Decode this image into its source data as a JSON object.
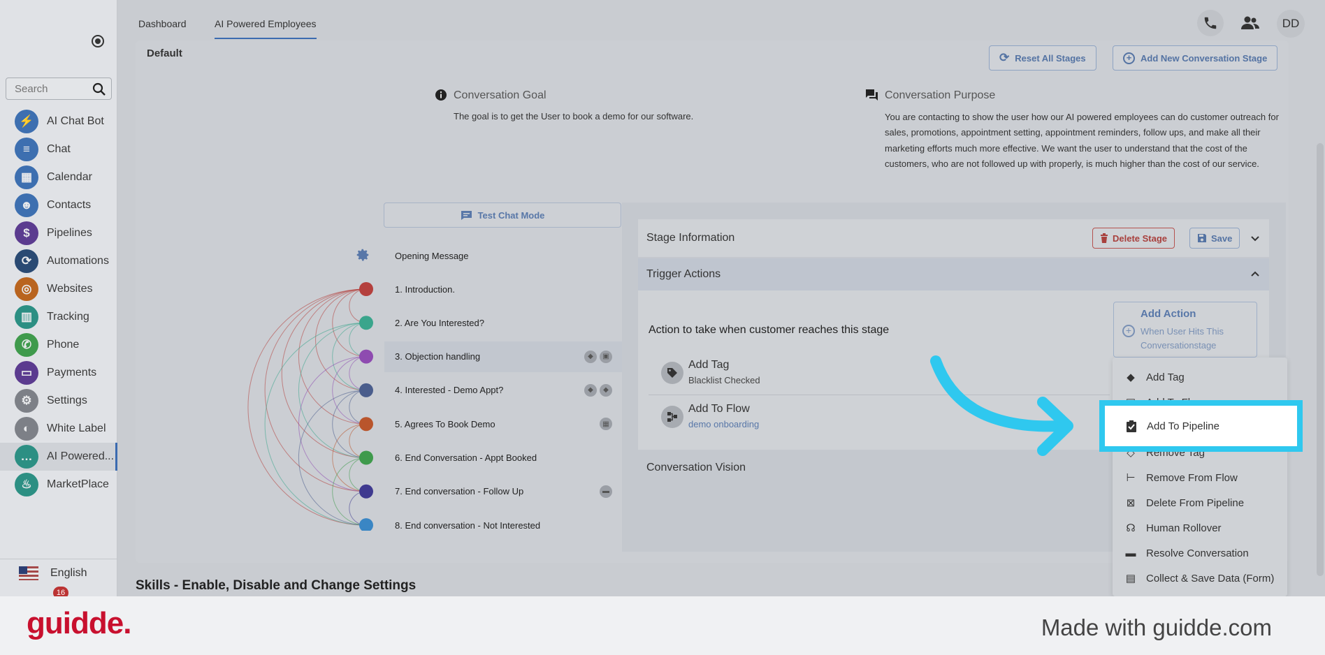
{
  "sidebar": {
    "search_placeholder": "Search",
    "items": [
      {
        "label": "AI Chat Bot",
        "icon": "lightning-icon",
        "color": "#3d6fb0",
        "glyph": "⚡"
      },
      {
        "label": "Chat",
        "icon": "chat-icon",
        "color": "#3d6fb0",
        "glyph": "≡"
      },
      {
        "label": "Calendar",
        "icon": "calendar-icon",
        "color": "#3d6fb0",
        "glyph": "▦"
      },
      {
        "label": "Contacts",
        "icon": "contacts-icon",
        "color": "#3d6fb0",
        "glyph": "☻"
      },
      {
        "label": "Pipelines",
        "icon": "dollar-icon",
        "color": "#5b3b8f",
        "glyph": "$"
      },
      {
        "label": "Automations",
        "icon": "automation-icon",
        "color": "#2a4a73",
        "glyph": "⟳"
      },
      {
        "label": "Websites",
        "icon": "websites-icon",
        "color": "#b9641f",
        "glyph": "◎"
      },
      {
        "label": "Tracking",
        "icon": "tracking-icon",
        "color": "#2c8f83",
        "glyph": "▥"
      },
      {
        "label": "Phone",
        "icon": "phone-icon",
        "color": "#3f9a4c",
        "glyph": "✆"
      },
      {
        "label": "Payments",
        "icon": "payments-icon",
        "color": "#5b3b8f",
        "glyph": "▭"
      },
      {
        "label": "Settings",
        "icon": "gear-icon",
        "color": "#7d8087",
        "glyph": "⚙"
      },
      {
        "label": "White Label",
        "icon": "palette-icon",
        "color": "#7d8087",
        "glyph": "◐"
      },
      {
        "label": "AI Powered...",
        "icon": "ai-chat-icon",
        "color": "#2c8f83",
        "glyph": "…"
      },
      {
        "label": "MarketPlace",
        "icon": "marketplace-icon",
        "color": "#2c8f83",
        "glyph": "♨"
      }
    ],
    "language": "English",
    "notification_count": "16"
  },
  "topbar": {
    "tabs": [
      "Dashboard",
      "AI Powered Employees"
    ],
    "avatar_initials": "DD"
  },
  "card": {
    "section_label": "Default",
    "reset_label": "Reset All Stages",
    "add_stage_label": "Add New Conversation Stage",
    "goal_title": "Conversation Goal",
    "goal_text": "The goal is to get the User to book a demo for our software.",
    "purpose_title": "Conversation Purpose",
    "purpose_text": "You are contacting to show the user how our AI powered employees can do customer outreach for sales, promotions, appointment setting, appointment reminders, follow ups, and make all their marketing efforts much more effective. We want the user to understand that the cost of the customers, who are not followed up with properly, is much higher than the cost of our service.",
    "test_chat_label": "Test Chat Mode",
    "opening_message": "Opening Message",
    "stages": [
      {
        "label": "1. Introduction.",
        "color": "#b4403d"
      },
      {
        "label": "2. Are You Interested?",
        "color": "#3aa58c"
      },
      {
        "label": "3. Objection handling",
        "color": "#8e4bb0"
      },
      {
        "label": "4. Interested - Demo Appt?",
        "color": "#4a5d8c"
      },
      {
        "label": "5. Agrees To Book Demo",
        "color": "#b9552c"
      },
      {
        "label": "6. End Conversation - Appt Booked",
        "color": "#3f9a4c"
      },
      {
        "label": "7. End conversation - Follow Up",
        "color": "#3f3a8f"
      },
      {
        "label": "8. End conversation - Not Interested",
        "color": "#3a86c4"
      }
    ]
  },
  "panel": {
    "stage_info_title": "Stage Information",
    "delete_stage_label": "Delete Stage",
    "save_label": "Save",
    "trigger_title": "Trigger Actions",
    "action_prompt": "Action to take when customer reaches this stage",
    "add_action_title": "Add Action",
    "add_action_sub": "When User Hits This Conversationstage",
    "actions": [
      {
        "title": "Add Tag",
        "sub": "Blacklist Checked"
      },
      {
        "title": "Add To Flow",
        "sub": "demo onboarding"
      }
    ],
    "vision_title": "Conversation Vision"
  },
  "dropdown": {
    "items": [
      "Add Tag",
      "Add To Flow",
      "Add To Pipeline",
      "Remove Tag",
      "Remove From Flow",
      "Delete From Pipeline",
      "Human Rollover",
      "Resolve Conversation",
      "Collect & Save Data (Form)"
    ],
    "highlighted": "Add To Pipeline"
  },
  "skills_title": "Skills - Enable, Disable and Change Settings",
  "footer": {
    "logo": "guidde.",
    "tagline": "Made with guidde.com"
  },
  "colors": {
    "accent": "#3b6bb0",
    "highlight": "#2fc8ef",
    "brand_red": "#c8102e"
  }
}
